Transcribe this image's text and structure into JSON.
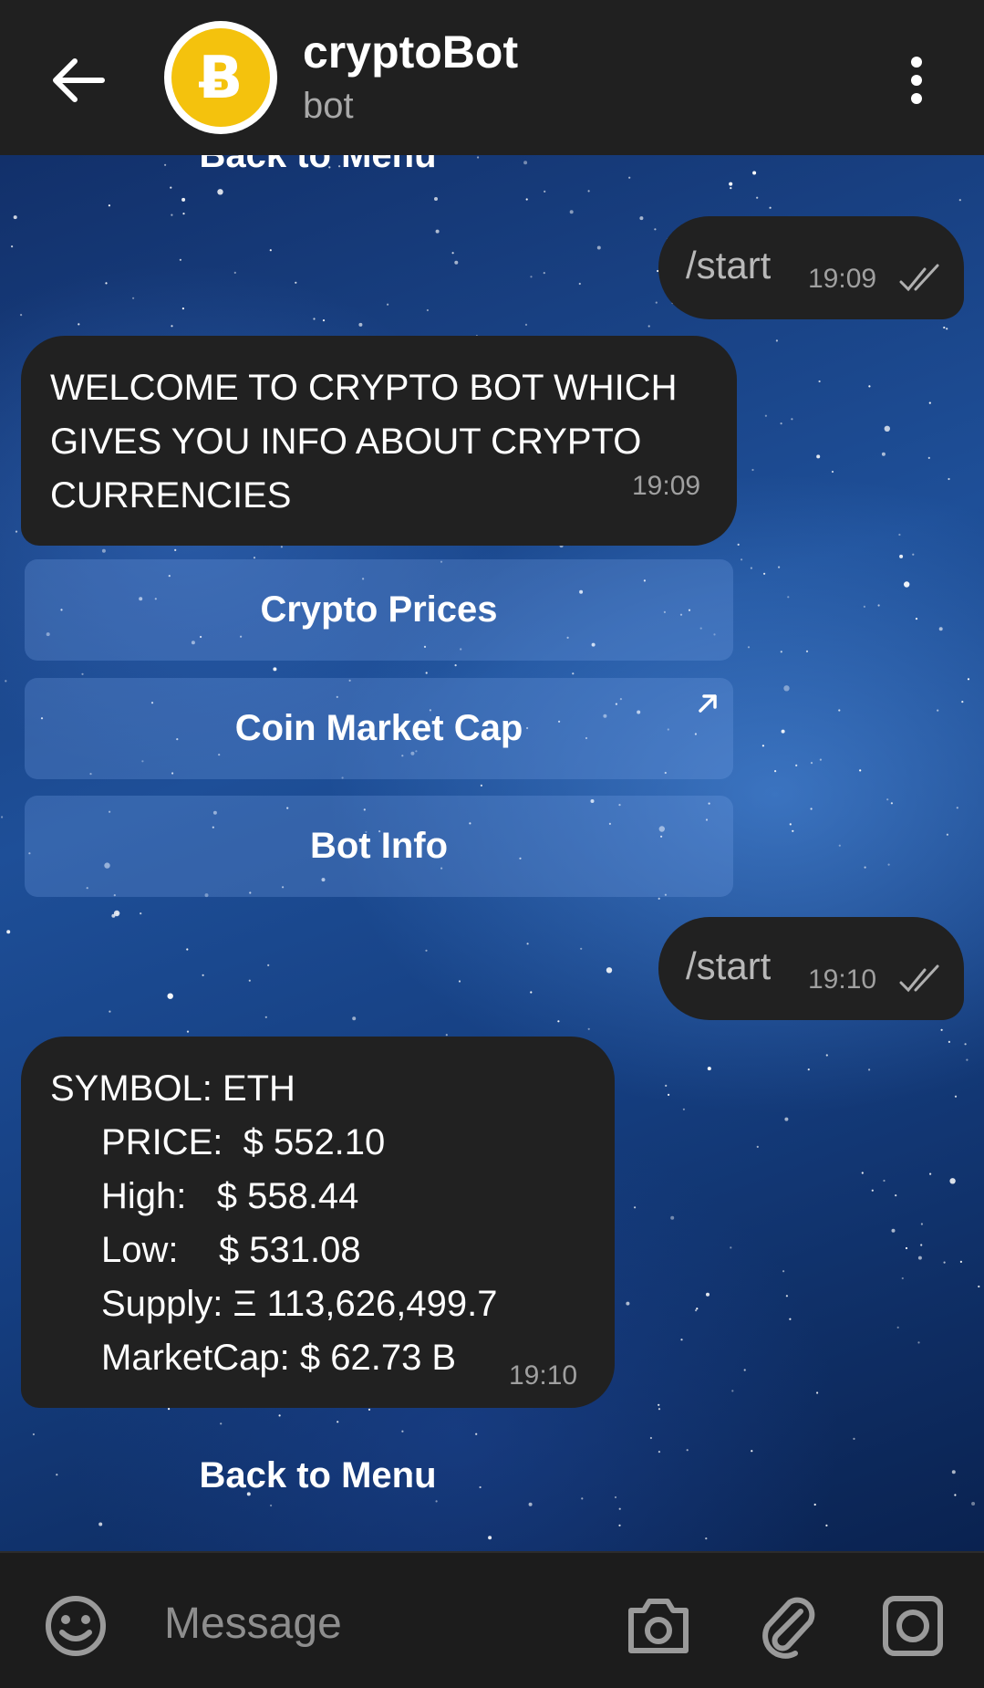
{
  "header": {
    "title": "cryptoBot",
    "subtitle": "bot",
    "avatar_letter": "Ƀ",
    "avatar_color": "#f4c20d"
  },
  "chat": {
    "top_partial_button": "Back to Menu",
    "messages": [
      {
        "type": "outgoing",
        "text": "/start",
        "time": "19:09",
        "status": "read"
      },
      {
        "type": "incoming",
        "text": "WELCOME TO CRYPTO BOT WHICH GIVES YOU INFO ABOUT CRYPTO CURRENCIES",
        "time": "19:09"
      },
      {
        "type": "outgoing",
        "text": "/start",
        "time": "19:10",
        "status": "read"
      },
      {
        "type": "incoming",
        "time": "19:10",
        "lines": [
          "SYMBOL: ETH",
          "PRICE:  $ 552.10",
          "High:   $ 558.44",
          "Low:    $ 531.08",
          "Supply: Ξ 113,626,499.7",
          "MarketCap: $ 62.73 B"
        ]
      }
    ],
    "keyboard": [
      {
        "label": "Crypto Prices",
        "external": false
      },
      {
        "label": "Coin Market Cap",
        "external": true
      },
      {
        "label": "Bot Info",
        "external": false
      }
    ],
    "bottom_button": "Back to Menu"
  },
  "input": {
    "placeholder": "Message"
  },
  "colors": {
    "header_bg": "#202020",
    "bubble_bg": "#212121",
    "input_bg": "#1c1c1c"
  }
}
